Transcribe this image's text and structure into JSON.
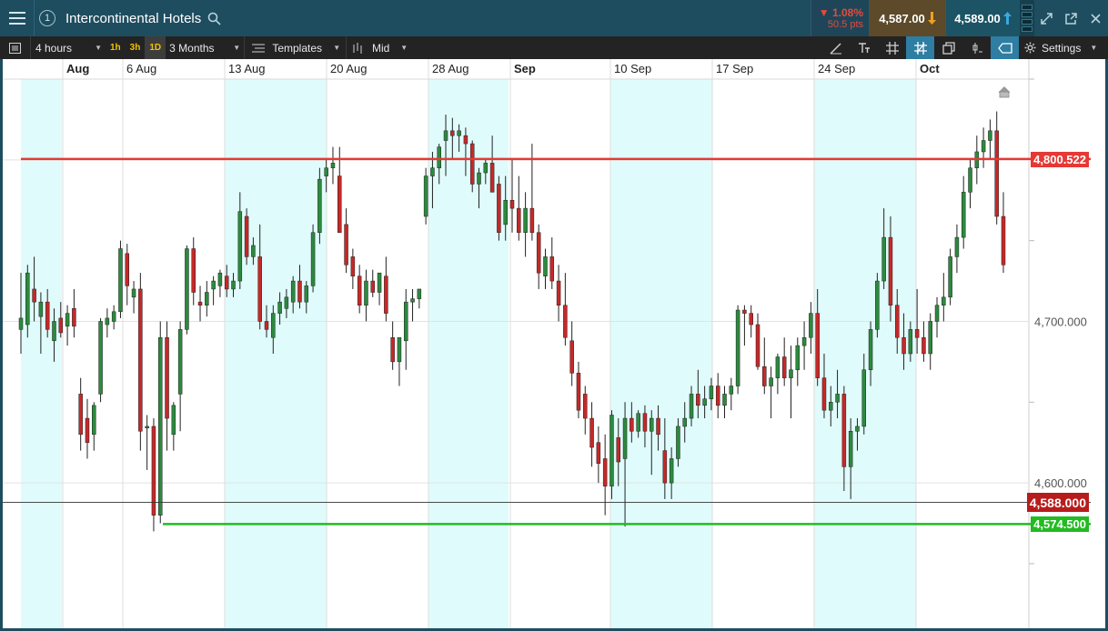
{
  "header": {
    "window_number": "1",
    "instrument": "Intercontinental Hotels",
    "change_pct": "▼ 1.08%",
    "change_pts": "50.5 pts",
    "sell_price": "4,587.00",
    "buy_price": "4,589.00"
  },
  "toolbar": {
    "interval": "4 hours",
    "quick_intervals": [
      "1h",
      "3h",
      "1D"
    ],
    "range": "3 Months",
    "templates": "Templates",
    "price_type": "Mid",
    "settings": "Settings"
  },
  "colors": {
    "header_bg": "#1e4d5f",
    "toolbar_bg": "#232323",
    "bull": "#2b8a3e",
    "bear": "#c62828",
    "resistance": "#e53935",
    "support": "#22bb22",
    "weekend_band": "#e0fbfb"
  },
  "chart_data": {
    "type": "candlestick",
    "x_axis_labels": [
      {
        "label": "Aug",
        "bold": true
      },
      {
        "label": "6 Aug",
        "bold": false
      },
      {
        "label": "13 Aug",
        "bold": false
      },
      {
        "label": "20 Aug",
        "bold": false
      },
      {
        "label": "28 Aug",
        "bold": false
      },
      {
        "label": "Sep",
        "bold": true
      },
      {
        "label": "10 Sep",
        "bold": false
      },
      {
        "label": "17 Sep",
        "bold": false
      },
      {
        "label": "24 Sep",
        "bold": false
      },
      {
        "label": "Oct",
        "bold": true
      }
    ],
    "y_axis_labels": [
      "4,800.000",
      "4,700.000",
      "4,600.000"
    ],
    "y_range": [
      4510,
      4850
    ],
    "horizontal_lines": [
      {
        "name": "resistance",
        "value": 4800.522,
        "label": "4,800.522"
      },
      {
        "name": "support",
        "value": 4574.5,
        "label": "4,574.500"
      },
      {
        "name": "current",
        "value": 4588.0,
        "label": "4,588.000"
      }
    ],
    "candles": [
      [
        4695,
        4730,
        4680,
        4702
      ],
      [
        4698,
        4735,
        4690,
        4730
      ],
      [
        4720,
        4740,
        4700,
        4712
      ],
      [
        4703,
        4718,
        4680,
        4712
      ],
      [
        4712,
        4720,
        4690,
        4695
      ],
      [
        4688,
        4708,
        4675,
        4700
      ],
      [
        4702,
        4712,
        4690,
        4693
      ],
      [
        4697,
        4710,
        4685,
        4705
      ],
      [
        4708,
        4720,
        4690,
        4697
      ],
      [
        4655,
        4665,
        4620,
        4630
      ],
      [
        4640,
        4652,
        4615,
        4625
      ],
      [
        4630,
        4650,
        4620,
        4648
      ],
      [
        4655,
        4702,
        4650,
        4700
      ],
      [
        4698,
        4708,
        4690,
        4702
      ],
      [
        4700,
        4710,
        4695,
        4706
      ],
      [
        4706,
        4750,
        4702,
        4745
      ],
      [
        4742,
        4748,
        4710,
        4722
      ],
      [
        4715,
        4725,
        4705,
        4720
      ],
      [
        4720,
        4730,
        4620,
        4632
      ],
      [
        4634,
        4642,
        4608,
        4635
      ],
      [
        4635,
        4640,
        4570,
        4580
      ],
      [
        4580,
        4700,
        4575,
        4690
      ],
      [
        4690,
        4700,
        4620,
        4640
      ],
      [
        4630,
        4650,
        4620,
        4648
      ],
      [
        4655,
        4700,
        4632,
        4695
      ],
      [
        4695,
        4747,
        4692,
        4745
      ],
      [
        4745,
        4752,
        4710,
        4718
      ],
      [
        4712,
        4722,
        4700,
        4710
      ],
      [
        4710,
        4725,
        4703,
        4718
      ],
      [
        4720,
        4728,
        4710,
        4725
      ],
      [
        4722,
        4732,
        4715,
        4730
      ],
      [
        4728,
        4735,
        4715,
        4720
      ],
      [
        4720,
        4730,
        4715,
        4725
      ],
      [
        4725,
        4780,
        4720,
        4768
      ],
      [
        4765,
        4770,
        4735,
        4740
      ],
      [
        4740,
        4752,
        4735,
        4747
      ],
      [
        4740,
        4760,
        4695,
        4700
      ],
      [
        4700,
        4710,
        4690,
        4695
      ],
      [
        4690,
        4710,
        4680,
        4705
      ],
      [
        4705,
        4718,
        4698,
        4712
      ],
      [
        4708,
        4720,
        4702,
        4715
      ],
      [
        4712,
        4728,
        4705,
        4725
      ],
      [
        4725,
        4735,
        4708,
        4712
      ],
      [
        4712,
        4725,
        4705,
        4722
      ],
      [
        4722,
        4760,
        4718,
        4755
      ],
      [
        4755,
        4795,
        4748,
        4788
      ],
      [
        4790,
        4800,
        4780,
        4795
      ],
      [
        4795,
        4808,
        4785,
        4798
      ],
      [
        4790,
        4808,
        4760,
        4755
      ],
      [
        4760,
        4770,
        4730,
        4735
      ],
      [
        4740,
        4745,
        4720,
        4728
      ],
      [
        4728,
        4735,
        4705,
        4710
      ],
      [
        4710,
        4732,
        4700,
        4725
      ],
      [
        4725,
        4732,
        4715,
        4718
      ],
      [
        4718,
        4730,
        4710,
        4730
      ],
      [
        4728,
        4740,
        4700,
        4705
      ],
      [
        4690,
        4700,
        4670,
        4675
      ],
      [
        4675,
        4685,
        4660,
        4690
      ],
      [
        4688,
        4720,
        4670,
        4712
      ],
      [
        4712,
        4720,
        4700,
        4714
      ],
      [
        4714,
        4720,
        4708,
        4720
      ],
      [
        4765,
        4795,
        4760,
        4790
      ],
      [
        4790,
        4805,
        4770,
        4795
      ],
      [
        4795,
        4810,
        4785,
        4808
      ],
      [
        4812,
        4828,
        4790,
        4818
      ],
      [
        4818,
        4826,
        4800,
        4815
      ],
      [
        4815,
        4822,
        4805,
        4818
      ],
      [
        4815,
        4820,
        4790,
        4810
      ],
      [
        4810,
        4812,
        4780,
        4785
      ],
      [
        4785,
        4795,
        4770,
        4792
      ],
      [
        4792,
        4800,
        4785,
        4798
      ],
      [
        4798,
        4815,
        4785,
        4780
      ],
      [
        4785,
        4790,
        4750,
        4755
      ],
      [
        4760,
        4790,
        4750,
        4775
      ],
      [
        4775,
        4800,
        4755,
        4770
      ],
      [
        4770,
        4790,
        4750,
        4755
      ],
      [
        4755,
        4780,
        4740,
        4770
      ],
      [
        4770,
        4810,
        4750,
        4755
      ],
      [
        4755,
        4760,
        4720,
        4730
      ],
      [
        4728,
        4745,
        4720,
        4740
      ],
      [
        4740,
        4752,
        4720,
        4725
      ],
      [
        4725,
        4735,
        4700,
        4710
      ],
      [
        4710,
        4730,
        4685,
        4690
      ],
      [
        4688,
        4700,
        4660,
        4668
      ],
      [
        4668,
        4675,
        4640,
        4645
      ],
      [
        4655,
        4660,
        4630,
        4640
      ],
      [
        4640,
        4650,
        4610,
        4622
      ],
      [
        4625,
        4635,
        4600,
        4612
      ],
      [
        4615,
        4630,
        4580,
        4598
      ],
      [
        4598,
        4645,
        4590,
        4642
      ],
      [
        4628,
        4640,
        4598,
        4613
      ],
      [
        4615,
        4650,
        4573,
        4640
      ],
      [
        4640,
        4650,
        4625,
        4632
      ],
      [
        4632,
        4645,
        4628,
        4643
      ],
      [
        4643,
        4648,
        4622,
        4632
      ],
      [
        4632,
        4645,
        4605,
        4640
      ],
      [
        4640,
        4648,
        4620,
        4630
      ],
      [
        4620,
        4640,
        4590,
        4600
      ],
      [
        4600,
        4622,
        4590,
        4615
      ],
      [
        4615,
        4640,
        4610,
        4635
      ],
      [
        4635,
        4650,
        4625,
        4640
      ],
      [
        4640,
        4660,
        4635,
        4655
      ],
      [
        4655,
        4670,
        4640,
        4648
      ],
      [
        4648,
        4660,
        4640,
        4652
      ],
      [
        4652,
        4665,
        4645,
        4660
      ],
      [
        4660,
        4668,
        4640,
        4648
      ],
      [
        4648,
        4660,
        4640,
        4655
      ],
      [
        4655,
        4665,
        4645,
        4660
      ],
      [
        4660,
        4710,
        4655,
        4707
      ],
      [
        4707,
        4710,
        4685,
        4705
      ],
      [
        4705,
        4710,
        4690,
        4698
      ],
      [
        4698,
        4705,
        4670,
        4672
      ],
      [
        4672,
        4690,
        4655,
        4660
      ],
      [
        4660,
        4672,
        4640,
        4665
      ],
      [
        4665,
        4680,
        4655,
        4678
      ],
      [
        4678,
        4690,
        4660,
        4665
      ],
      [
        4665,
        4685,
        4640,
        4670
      ],
      [
        4670,
        4690,
        4660,
        4685
      ],
      [
        4685,
        4700,
        4670,
        4690
      ],
      [
        4690,
        4712,
        4680,
        4705
      ],
      [
        4705,
        4720,
        4660,
        4665
      ],
      [
        4665,
        4680,
        4640,
        4645
      ],
      [
        4645,
        4660,
        4635,
        4650
      ],
      [
        4650,
        4670,
        4640,
        4655
      ],
      [
        4655,
        4660,
        4595,
        4610
      ],
      [
        4610,
        4640,
        4590,
        4632
      ],
      [
        4632,
        4640,
        4620,
        4635
      ],
      [
        4635,
        4680,
        4630,
        4670
      ],
      [
        4670,
        4700,
        4660,
        4695
      ],
      [
        4695,
        4730,
        4690,
        4725
      ],
      [
        4725,
        4770,
        4720,
        4752
      ],
      [
        4752,
        4765,
        4700,
        4710
      ],
      [
        4710,
        4720,
        4680,
        4690
      ],
      [
        4690,
        4705,
        4670,
        4680
      ],
      [
        4680,
        4700,
        4675,
        4695
      ],
      [
        4695,
        4720,
        4680,
        4690
      ],
      [
        4690,
        4700,
        4675,
        4680
      ],
      [
        4680,
        4705,
        4670,
        4700
      ],
      [
        4700,
        4715,
        4690,
        4710
      ],
      [
        4710,
        4730,
        4700,
        4715
      ],
      [
        4715,
        4745,
        4710,
        4740
      ],
      [
        4740,
        4760,
        4730,
        4752
      ],
      [
        4752,
        4790,
        4745,
        4780
      ],
      [
        4780,
        4800,
        4770,
        4795
      ],
      [
        4795,
        4815,
        4785,
        4805
      ],
      [
        4805,
        4820,
        4795,
        4812
      ],
      [
        4812,
        4825,
        4800,
        4818
      ],
      [
        4818,
        4830,
        4760,
        4765
      ],
      [
        4765,
        4780,
        4730,
        4735
      ]
    ]
  }
}
